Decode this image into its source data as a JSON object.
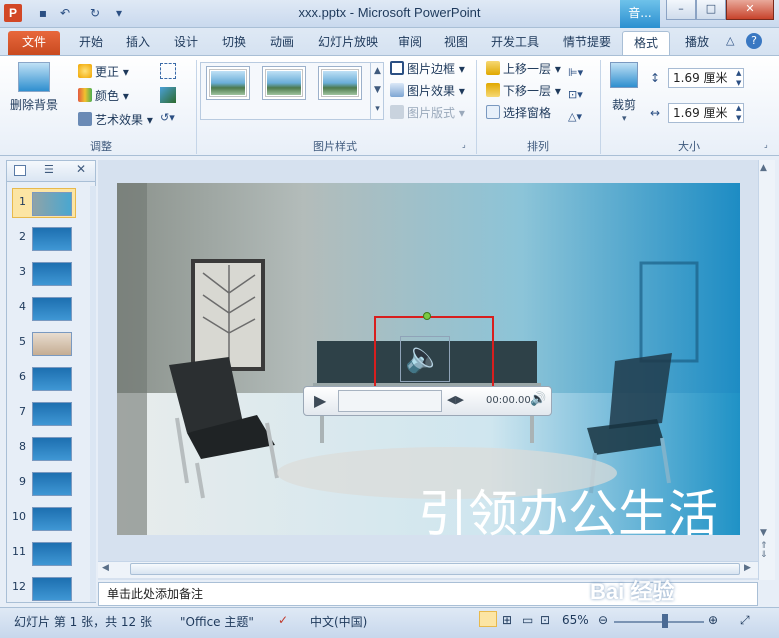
{
  "window": {
    "doc_title": "xxx.pptx - Microsoft PowerPoint",
    "context_tab": "音...",
    "app_icon": "P",
    "minimize": "–",
    "maximize": "□",
    "close": "✕"
  },
  "tabs": [
    {
      "label": "文件"
    },
    {
      "label": "开始"
    },
    {
      "label": "插入"
    },
    {
      "label": "设计"
    },
    {
      "label": "切换"
    },
    {
      "label": "动画"
    },
    {
      "label": "幻灯片放映"
    },
    {
      "label": "审阅"
    },
    {
      "label": "视图"
    },
    {
      "label": "开发工具"
    },
    {
      "label": "情节提要"
    },
    {
      "label": "格式"
    },
    {
      "label": "播放"
    }
  ],
  "ribbon": {
    "adjust": {
      "remove_bg": "删除背景",
      "corrections": "更正",
      "color": "颜色",
      "artistic": "艺术效果",
      "label": "调整"
    },
    "styles": {
      "border": "图片边框",
      "effects": "图片效果",
      "layout": "图片版式",
      "label": "图片样式"
    },
    "arrange": {
      "bring_forward": "上移一层",
      "send_backward": "下移一层",
      "selection_pane": "选择窗格",
      "label": "排列"
    },
    "size": {
      "crop": "裁剪",
      "height": "1.69 厘米",
      "width": "1.69 厘米",
      "label": "大小"
    }
  },
  "slides": [
    1,
    2,
    3,
    4,
    5,
    6,
    7,
    8,
    9,
    10,
    11,
    12
  ],
  "slide_labels": [
    "1",
    "2",
    "3",
    "4",
    "5",
    "6",
    "7",
    "8",
    "9",
    "10",
    "11",
    "12"
  ],
  "slide_text": "引领办公生活",
  "media": {
    "time": "00:00.00"
  },
  "notes_placeholder": "单击此处添加备注",
  "status": {
    "slide_info": "幻灯片 第 1 张，共 12 张",
    "theme": "\"Office 主题\"",
    "language": "中文(中国)",
    "zoom": "65%"
  },
  "watermark": "Bai 经验"
}
